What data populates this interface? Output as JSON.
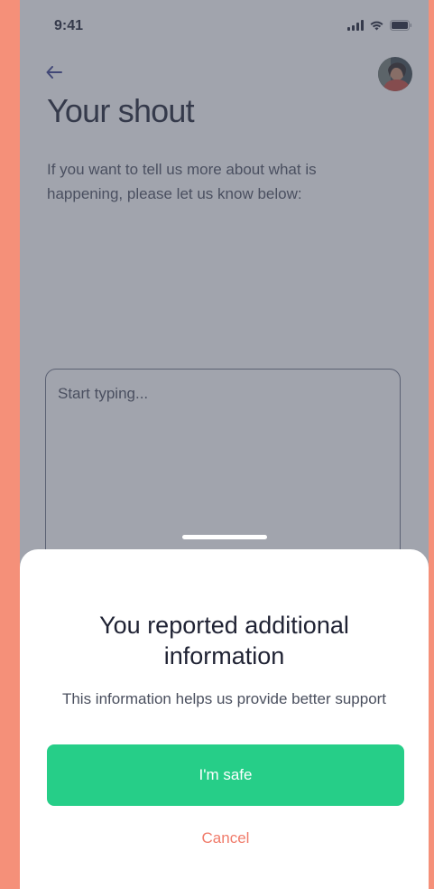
{
  "status_bar": {
    "time": "9:41",
    "icons": [
      "signal-icon",
      "wifi-icon",
      "battery-icon"
    ]
  },
  "header": {
    "back_icon": "arrow-left-icon",
    "avatar": "user-avatar",
    "title": "Your shout"
  },
  "main": {
    "intro": "If you want to tell us more about what is happening, please let us know below:",
    "input_placeholder": "Start typing..."
  },
  "sheet": {
    "title": "You reported additional information",
    "subtitle": "This information helps us provide better support",
    "primary_label": "I'm safe",
    "cancel_label": "Cancel"
  },
  "colors": {
    "outer_background": "#F59079",
    "accent_green": "#26CE88",
    "cancel_coral": "#F07B6A",
    "text_dark": "#1F2233",
    "back_arrow": "#3A3F8F"
  }
}
